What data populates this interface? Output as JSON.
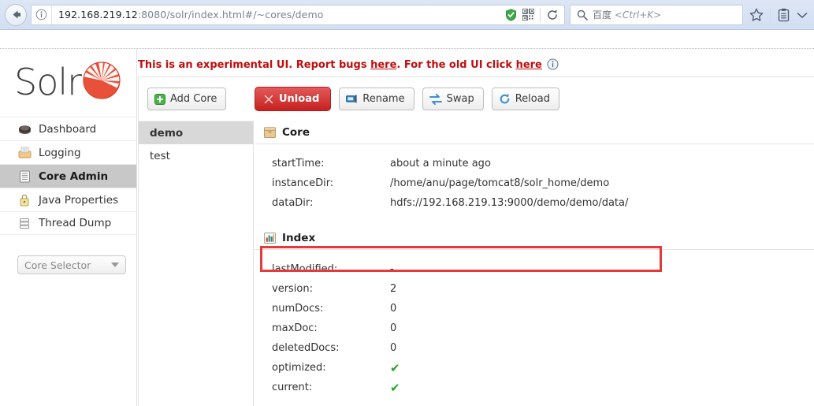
{
  "browser": {
    "url_main": "192.168.219.12",
    "url_rest": ":8080/solr/index.html#/~cores/demo",
    "search_placeholder_cn": "百度",
    "search_placeholder_hint": " <Ctrl+K>",
    "icons": {
      "back": "back-arrow-icon",
      "site_info": "site-info-icon",
      "shield": "shield-icon",
      "qr": "qr-code-icon",
      "reload": "reload-icon",
      "search": "search-icon",
      "bookmark": "star-bookmark-icon",
      "library": "library-clipboard-icon",
      "overflow": "chevron-down-icon"
    }
  },
  "banner": {
    "text_1": "This is an experimental UI. Report bugs ",
    "link_1": "here",
    "text_2": ". For the old UI click ",
    "link_2": "here",
    "info_icon": "info-icon"
  },
  "logo": {
    "text": "Solr",
    "mark": "solr-sunburst-logo"
  },
  "sidebar": {
    "items": [
      {
        "label": "Dashboard",
        "icon": "dashboard-icon",
        "active": false
      },
      {
        "label": "Logging",
        "icon": "logging-icon",
        "active": false
      },
      {
        "label": "Core Admin",
        "icon": "core-admin-icon",
        "active": true
      },
      {
        "label": "Java Properties",
        "icon": "java-properties-icon",
        "active": false
      },
      {
        "label": "Thread Dump",
        "icon": "thread-dump-icon",
        "active": false
      }
    ],
    "core_selector": {
      "label": "Core Selector",
      "caret": "chevron-down-icon"
    }
  },
  "toolbar": {
    "add_core": "Add Core",
    "unload": "Unload",
    "rename": "Rename",
    "swap": "Swap",
    "reload": "Reload"
  },
  "core_list": [
    {
      "name": "demo",
      "active": true
    },
    {
      "name": "test",
      "active": false
    }
  ],
  "core_section": {
    "title": "Core",
    "icon": "core-box-icon",
    "rows": [
      {
        "key": "startTime:",
        "value": "about a minute ago"
      },
      {
        "key": "instanceDir:",
        "value": "/home/anu/page/tomcat8/solr_home/demo"
      },
      {
        "key": "dataDir:",
        "value": "hdfs://192.168.219.13:9000/demo/demo/data/"
      }
    ]
  },
  "index_section": {
    "title": "Index",
    "icon": "index-chart-icon",
    "rows": [
      {
        "key": "lastModified:",
        "value": "-",
        "check": false
      },
      {
        "key": "version:",
        "value": "2",
        "check": false
      },
      {
        "key": "numDocs:",
        "value": "0",
        "check": false
      },
      {
        "key": "maxDoc:",
        "value": "0",
        "check": false
      },
      {
        "key": "deletedDocs:",
        "value": "0",
        "check": false
      },
      {
        "key": "optimized:",
        "value": "✔",
        "check": true
      },
      {
        "key": "current:",
        "value": "✔",
        "check": true
      }
    ]
  },
  "highlight": {
    "target": "dataDir",
    "color": "#e33a3a"
  }
}
